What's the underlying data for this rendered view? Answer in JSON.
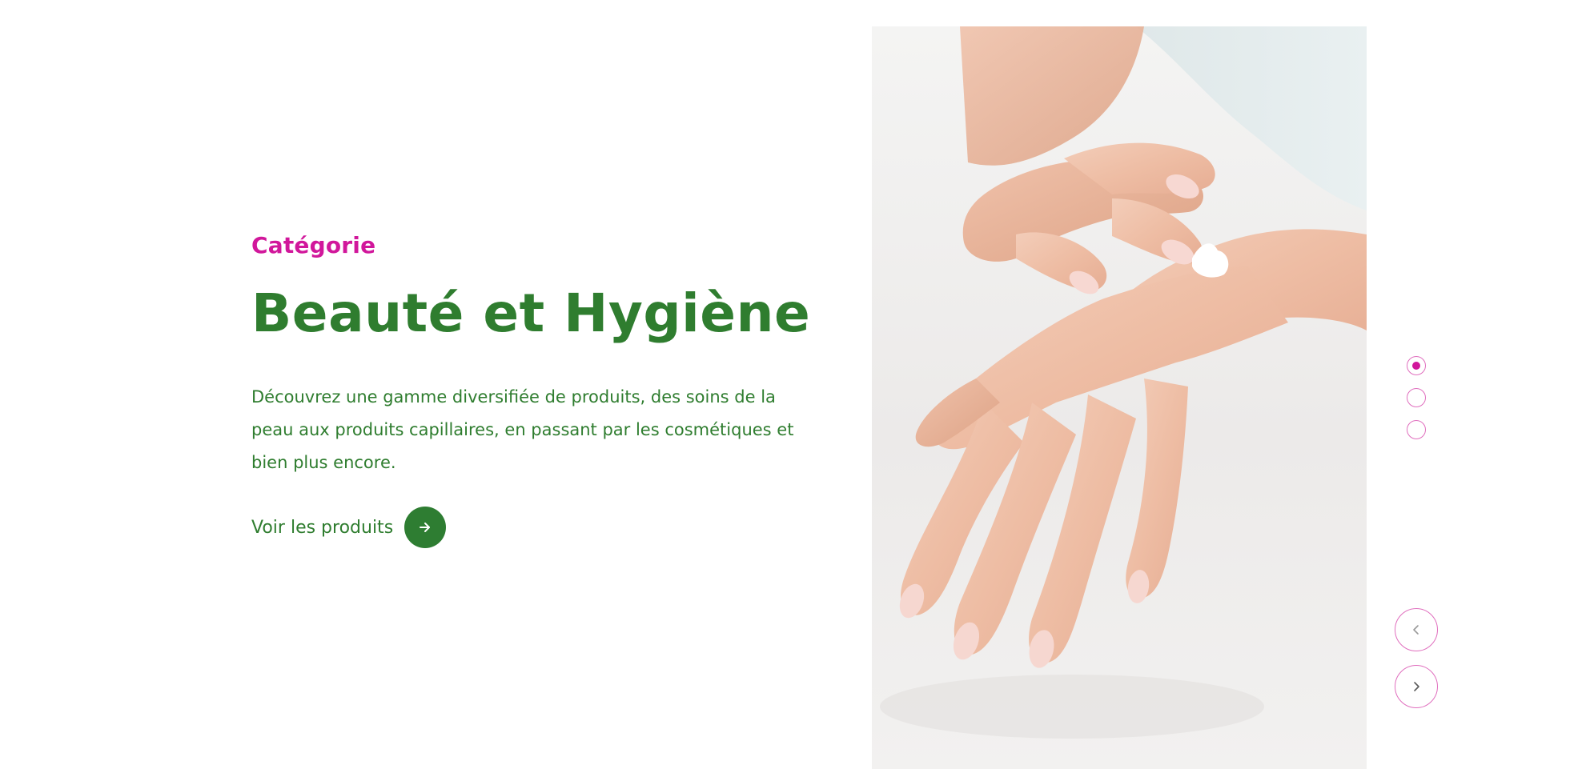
{
  "hero": {
    "category_label": "Catégorie",
    "title": "Beauté et Hygiène",
    "description": "Découvrez une gamme diversifiée de produits, des soins de la peau aux produits capillaires, en passant par les cosmétiques et bien plus encore.",
    "cta_label": "Voir les produits",
    "cta_icon": "arrow-right-icon"
  },
  "image": {
    "subject": "hands-applying-cream-photo"
  },
  "pager": {
    "count": 3,
    "active_index": 0
  },
  "navigation": {
    "prev_icon": "chevron-left-icon",
    "next_icon": "chevron-right-icon"
  },
  "colors": {
    "accent_pink": "#d1179b",
    "brand_green": "#2f7d2f",
    "button_green": "#2e7d32"
  }
}
